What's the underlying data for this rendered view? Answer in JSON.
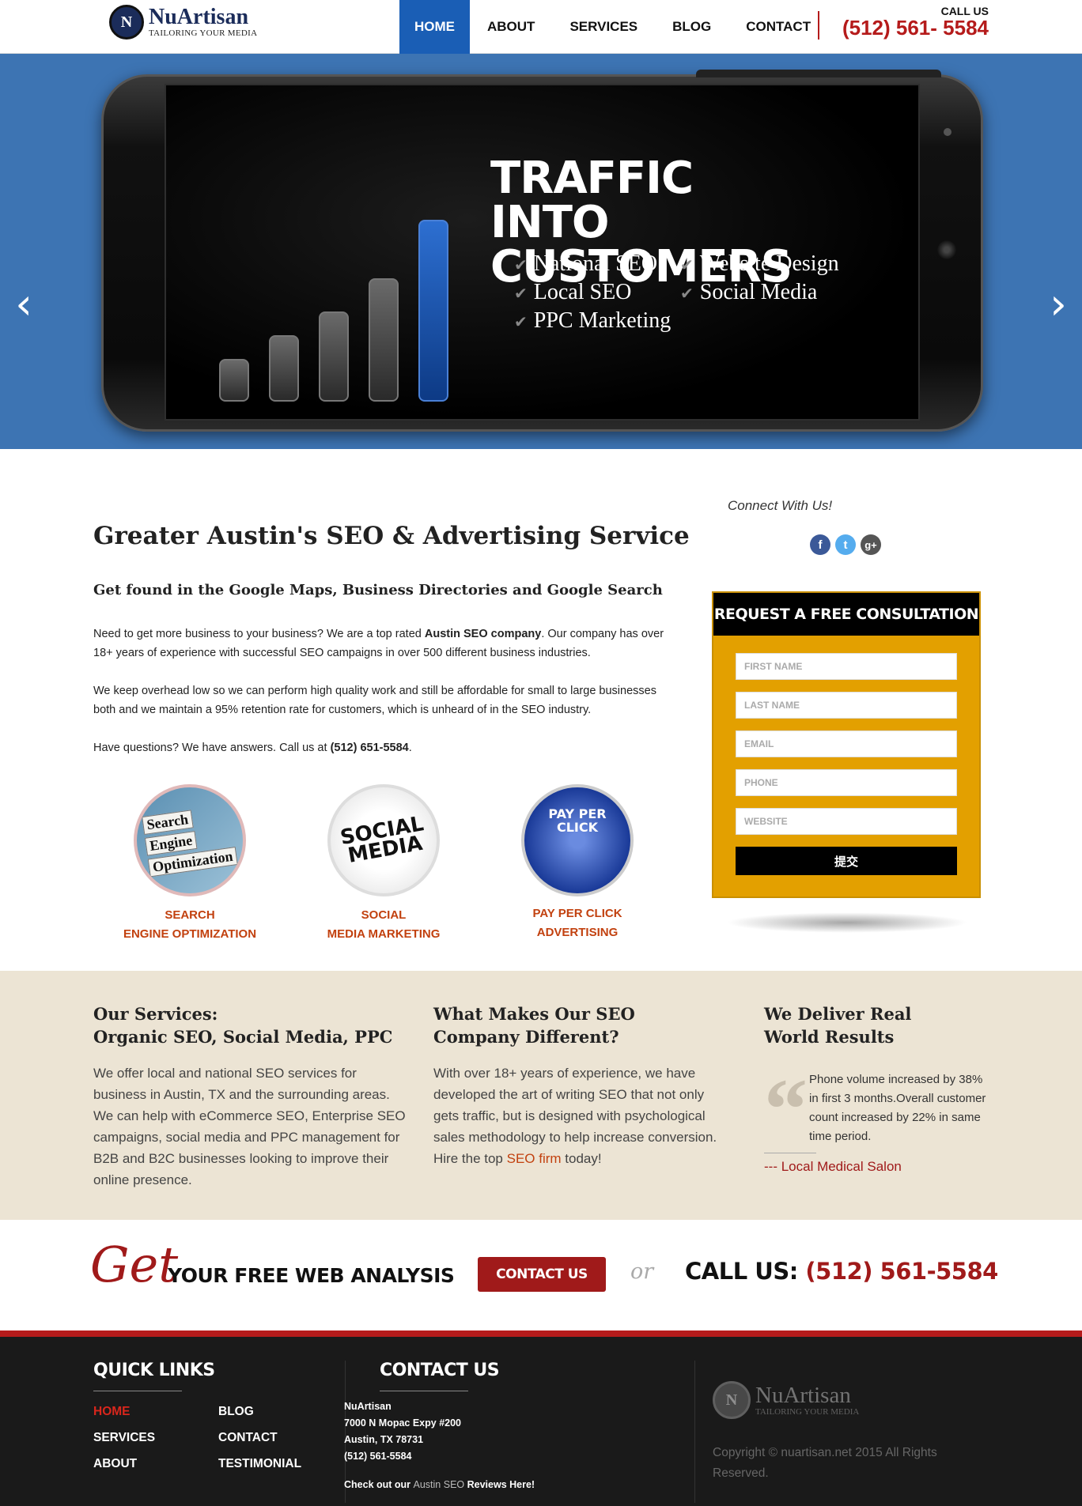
{
  "header": {
    "logo": {
      "name": "NuArtisan",
      "tagline": "TAILORING YOUR MEDIA",
      "badge": "N"
    },
    "nav": [
      "HOME",
      "ABOUT",
      "SERVICES",
      "BLOG",
      "CONTACT"
    ],
    "active_nav": "HOME",
    "call_label": "CALL US",
    "call_phone": "(512) 561- 5584"
  },
  "hero": {
    "title_line1": "TRAFFIC INTO",
    "title_line2": "CUSTOMERS",
    "items": [
      "National SEO",
      "Website Design",
      "Local SEO",
      "Social Media",
      "PPC Marketing"
    ],
    "bars": [
      0.12,
      0.27,
      0.42,
      0.63,
      1.0
    ],
    "prev": "‹",
    "next": "›"
  },
  "main": {
    "title": "Greater Austin's SEO & Advertising Service",
    "subtitle": "Get found in the Google Maps, Business Directories and Google Search",
    "p1_a": "Need to get more business to your business? We are a top rated ",
    "p1_b": "Austin SEO company",
    "p1_c": ". Our company has over 18+ years of experience with successful SEO campaigns in over 500 different business industries.",
    "p2": "We keep overhead low so we can perform high quality work and still be affordable for small to large businesses both and we maintain a 95% retention rate for customers, which is unheard of in the SEO industry.",
    "p3_a": "Have questions? We have answers. Call us at ",
    "p3_b": "(512) 651-5584",
    "p3_c": ".",
    "services": [
      {
        "line1": "SEARCH",
        "line2": "ENGINE OPTIMIZATION",
        "tiles": [
          "Search",
          "Engine",
          "Optimization"
        ]
      },
      {
        "line1": "SOCIAL",
        "line2": "MEDIA MARKETING",
        "art": "SOCIAL MEDIA"
      },
      {
        "line1": "PAY PER CLICK",
        "line2": "ADVERTISING",
        "art": "PAY PER CLICK"
      }
    ]
  },
  "sidebar": {
    "connect": "Connect With Us!",
    "socials": [
      {
        "name": "facebook-icon",
        "glyph": "f",
        "color": "#3b5998"
      },
      {
        "name": "twitter-icon",
        "glyph": "t",
        "color": "#55acee"
      },
      {
        "name": "googleplus-icon",
        "glyph": "g+",
        "color": "#555555"
      }
    ],
    "form": {
      "title": "REQUEST A FREE CONSULTATION",
      "first_name": "FIRST NAME",
      "last_name": "LAST NAME",
      "email": "EMAIL",
      "phone": "PHONE",
      "website": "WEBSITE",
      "submit": "提交"
    }
  },
  "band": {
    "col1_title_1": "Our Services:",
    "col1_title_2": "Organic SEO, Social Media, PPC",
    "col1_text": "We offer local and national SEO services for business in Austin, TX and the surrounding areas. We can help with eCommerce SEO, Enterprise SEO campaigns, social media and PPC management for B2B and B2C businesses looking to improve their online presence.",
    "col2_title_1": "What Makes Our SEO",
    "col2_title_2": "Company Different?",
    "col2_text_a": "With over 18+ years of experience, we have developed the art of writing SEO that not only gets traffic, but is designed with psychological sales methodology to help increase conversion. Hire the top ",
    "col2_link": "SEO firm",
    "col2_text_b": " today!",
    "col3_title_1": "We Deliver Real",
    "col3_title_2": "World Results",
    "quote_mark": "“",
    "quote": "Phone volume increased by 38% in first 3 months.Overall customer count increased by 22% in same time period.",
    "author": "--- Local Medical Salon"
  },
  "cta": {
    "get": "Get",
    "text": "YOUR FREE WEB ANALYSIS",
    "button": "CONTACT US",
    "or": "or",
    "call_label": "CALL US:",
    "phone": "(512) 561-5584"
  },
  "footer": {
    "quick_links_title": "QUICK LINKS",
    "links_col1": [
      "HOME",
      "SERVICES",
      "ABOUT"
    ],
    "links_col2": [
      "BLOG",
      "CONTACT",
      "TESTIMONIAL"
    ],
    "contact_title": "CONTACT US",
    "address": [
      "NuArtisan",
      "7000 N Mopac Expy #200",
      "Austin, TX 78731",
      "(512) 561-5584"
    ],
    "reviews_a": "Check out our ",
    "reviews_link": "Austin SEO",
    "reviews_b": " Reviews Here!",
    "logo_name": "NuArtisan",
    "logo_tag": "TAILORING YOUR MEDIA",
    "logo_badge": "N",
    "copyright": "Copyright © nuartisan.net 2015 All Rights Reserved."
  }
}
